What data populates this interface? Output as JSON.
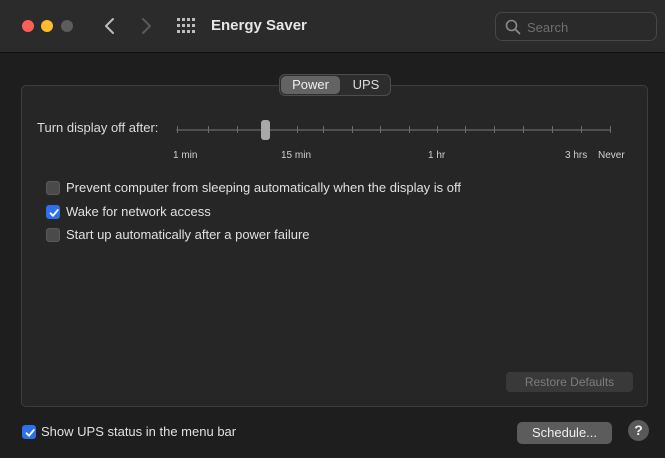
{
  "window": {
    "title": "Energy Saver",
    "search_placeholder": "Search"
  },
  "tabs": [
    {
      "label": "Power",
      "selected": true
    },
    {
      "label": "UPS",
      "selected": false
    }
  ],
  "display_sleep": {
    "label": "Turn display off after:",
    "tick_labels": [
      "1 min",
      "15 min",
      "1 hr",
      "3 hrs",
      "Never"
    ],
    "value": "15 min"
  },
  "options": [
    {
      "label": "Prevent computer from sleeping automatically when the display is off",
      "checked": false
    },
    {
      "label": "Wake for network access",
      "checked": true
    },
    {
      "label": "Start up automatically after a power failure",
      "checked": false
    }
  ],
  "footer": {
    "restore_defaults": "Restore Defaults",
    "show_ups_status": {
      "label": "Show UPS status in the menu bar",
      "checked": true
    },
    "schedule_button": "Schedule...",
    "help_button": "?"
  },
  "colors": {
    "accent": "#2f6fea",
    "close": "#fe5f57",
    "minimize": "#febc2e"
  }
}
